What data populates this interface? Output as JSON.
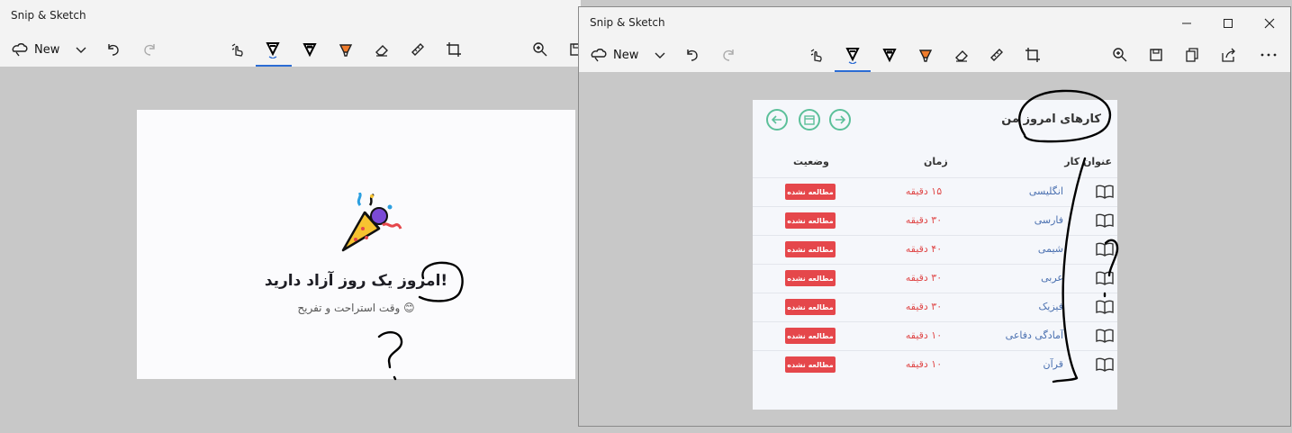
{
  "background_window": {
    "title": "Snip & Sketch",
    "new_label": "New",
    "content": {
      "headline": "امروز یک روز آزاد دارید!",
      "subtitle": "وقت استراحت و تفریح 😊",
      "party_icon": "party-popper-icon"
    }
  },
  "front_window": {
    "title": "Snip & Sketch",
    "new_label": "New",
    "content": {
      "title": "کارهای امروز من",
      "columns": {
        "task": "عنوان کار",
        "time": "زمان",
        "status": "وضعیت"
      },
      "rows": [
        {
          "subject": "انگلیسی",
          "duration": "۱۵ دقیقه",
          "status": "مطالعه نشده"
        },
        {
          "subject": "فارسی",
          "duration": "۳۰ دقیقه",
          "status": "مطالعه نشده"
        },
        {
          "subject": "شیمی",
          "duration": "۴۰ دقیقه",
          "status": "مطالعه نشده"
        },
        {
          "subject": "عربی",
          "duration": "۳۰ دقیقه",
          "status": "مطالعه نشده"
        },
        {
          "subject": "فیزیک",
          "duration": "۳۰ دقیقه",
          "status": "مطالعه نشده"
        },
        {
          "subject": "آمادگی دفاعی",
          "duration": "۱۰ دقیقه",
          "status": "مطالعه نشده"
        },
        {
          "subject": "قرآن",
          "duration": "۱۰ دقیقه",
          "status": "مطالعه نشده"
        }
      ]
    }
  },
  "colors": {
    "accent": "#2b6cd4",
    "badge": "#e5474b",
    "nav_button": "#5cc09a",
    "highlighter": "#f07c2c",
    "ink": "#000000"
  }
}
